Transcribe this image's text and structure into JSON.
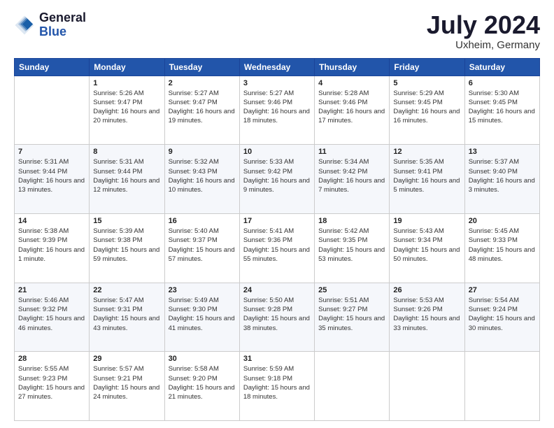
{
  "logo": {
    "line1": "General",
    "line2": "Blue"
  },
  "title": "July 2024",
  "subtitle": "Uxheim, Germany",
  "headers": [
    "Sunday",
    "Monday",
    "Tuesday",
    "Wednesday",
    "Thursday",
    "Friday",
    "Saturday"
  ],
  "weeks": [
    [
      {
        "day": "",
        "sunrise": "",
        "sunset": "",
        "daylight": ""
      },
      {
        "day": "1",
        "sunrise": "Sunrise: 5:26 AM",
        "sunset": "Sunset: 9:47 PM",
        "daylight": "Daylight: 16 hours and 20 minutes."
      },
      {
        "day": "2",
        "sunrise": "Sunrise: 5:27 AM",
        "sunset": "Sunset: 9:47 PM",
        "daylight": "Daylight: 16 hours and 19 minutes."
      },
      {
        "day": "3",
        "sunrise": "Sunrise: 5:27 AM",
        "sunset": "Sunset: 9:46 PM",
        "daylight": "Daylight: 16 hours and 18 minutes."
      },
      {
        "day": "4",
        "sunrise": "Sunrise: 5:28 AM",
        "sunset": "Sunset: 9:46 PM",
        "daylight": "Daylight: 16 hours and 17 minutes."
      },
      {
        "day": "5",
        "sunrise": "Sunrise: 5:29 AM",
        "sunset": "Sunset: 9:45 PM",
        "daylight": "Daylight: 16 hours and 16 minutes."
      },
      {
        "day": "6",
        "sunrise": "Sunrise: 5:30 AM",
        "sunset": "Sunset: 9:45 PM",
        "daylight": "Daylight: 16 hours and 15 minutes."
      }
    ],
    [
      {
        "day": "7",
        "sunrise": "Sunrise: 5:31 AM",
        "sunset": "Sunset: 9:44 PM",
        "daylight": "Daylight: 16 hours and 13 minutes."
      },
      {
        "day": "8",
        "sunrise": "Sunrise: 5:31 AM",
        "sunset": "Sunset: 9:44 PM",
        "daylight": "Daylight: 16 hours and 12 minutes."
      },
      {
        "day": "9",
        "sunrise": "Sunrise: 5:32 AM",
        "sunset": "Sunset: 9:43 PM",
        "daylight": "Daylight: 16 hours and 10 minutes."
      },
      {
        "day": "10",
        "sunrise": "Sunrise: 5:33 AM",
        "sunset": "Sunset: 9:42 PM",
        "daylight": "Daylight: 16 hours and 9 minutes."
      },
      {
        "day": "11",
        "sunrise": "Sunrise: 5:34 AM",
        "sunset": "Sunset: 9:42 PM",
        "daylight": "Daylight: 16 hours and 7 minutes."
      },
      {
        "day": "12",
        "sunrise": "Sunrise: 5:35 AM",
        "sunset": "Sunset: 9:41 PM",
        "daylight": "Daylight: 16 hours and 5 minutes."
      },
      {
        "day": "13",
        "sunrise": "Sunrise: 5:37 AM",
        "sunset": "Sunset: 9:40 PM",
        "daylight": "Daylight: 16 hours and 3 minutes."
      }
    ],
    [
      {
        "day": "14",
        "sunrise": "Sunrise: 5:38 AM",
        "sunset": "Sunset: 9:39 PM",
        "daylight": "Daylight: 16 hours and 1 minute."
      },
      {
        "day": "15",
        "sunrise": "Sunrise: 5:39 AM",
        "sunset": "Sunset: 9:38 PM",
        "daylight": "Daylight: 15 hours and 59 minutes."
      },
      {
        "day": "16",
        "sunrise": "Sunrise: 5:40 AM",
        "sunset": "Sunset: 9:37 PM",
        "daylight": "Daylight: 15 hours and 57 minutes."
      },
      {
        "day": "17",
        "sunrise": "Sunrise: 5:41 AM",
        "sunset": "Sunset: 9:36 PM",
        "daylight": "Daylight: 15 hours and 55 minutes."
      },
      {
        "day": "18",
        "sunrise": "Sunrise: 5:42 AM",
        "sunset": "Sunset: 9:35 PM",
        "daylight": "Daylight: 15 hours and 53 minutes."
      },
      {
        "day": "19",
        "sunrise": "Sunrise: 5:43 AM",
        "sunset": "Sunset: 9:34 PM",
        "daylight": "Daylight: 15 hours and 50 minutes."
      },
      {
        "day": "20",
        "sunrise": "Sunrise: 5:45 AM",
        "sunset": "Sunset: 9:33 PM",
        "daylight": "Daylight: 15 hours and 48 minutes."
      }
    ],
    [
      {
        "day": "21",
        "sunrise": "Sunrise: 5:46 AM",
        "sunset": "Sunset: 9:32 PM",
        "daylight": "Daylight: 15 hours and 46 minutes."
      },
      {
        "day": "22",
        "sunrise": "Sunrise: 5:47 AM",
        "sunset": "Sunset: 9:31 PM",
        "daylight": "Daylight: 15 hours and 43 minutes."
      },
      {
        "day": "23",
        "sunrise": "Sunrise: 5:49 AM",
        "sunset": "Sunset: 9:30 PM",
        "daylight": "Daylight: 15 hours and 41 minutes."
      },
      {
        "day": "24",
        "sunrise": "Sunrise: 5:50 AM",
        "sunset": "Sunset: 9:28 PM",
        "daylight": "Daylight: 15 hours and 38 minutes."
      },
      {
        "day": "25",
        "sunrise": "Sunrise: 5:51 AM",
        "sunset": "Sunset: 9:27 PM",
        "daylight": "Daylight: 15 hours and 35 minutes."
      },
      {
        "day": "26",
        "sunrise": "Sunrise: 5:53 AM",
        "sunset": "Sunset: 9:26 PM",
        "daylight": "Daylight: 15 hours and 33 minutes."
      },
      {
        "day": "27",
        "sunrise": "Sunrise: 5:54 AM",
        "sunset": "Sunset: 9:24 PM",
        "daylight": "Daylight: 15 hours and 30 minutes."
      }
    ],
    [
      {
        "day": "28",
        "sunrise": "Sunrise: 5:55 AM",
        "sunset": "Sunset: 9:23 PM",
        "daylight": "Daylight: 15 hours and 27 minutes."
      },
      {
        "day": "29",
        "sunrise": "Sunrise: 5:57 AM",
        "sunset": "Sunset: 9:21 PM",
        "daylight": "Daylight: 15 hours and 24 minutes."
      },
      {
        "day": "30",
        "sunrise": "Sunrise: 5:58 AM",
        "sunset": "Sunset: 9:20 PM",
        "daylight": "Daylight: 15 hours and 21 minutes."
      },
      {
        "day": "31",
        "sunrise": "Sunrise: 5:59 AM",
        "sunset": "Sunset: 9:18 PM",
        "daylight": "Daylight: 15 hours and 18 minutes."
      },
      {
        "day": "",
        "sunrise": "",
        "sunset": "",
        "daylight": ""
      },
      {
        "day": "",
        "sunrise": "",
        "sunset": "",
        "daylight": ""
      },
      {
        "day": "",
        "sunrise": "",
        "sunset": "",
        "daylight": ""
      }
    ]
  ]
}
